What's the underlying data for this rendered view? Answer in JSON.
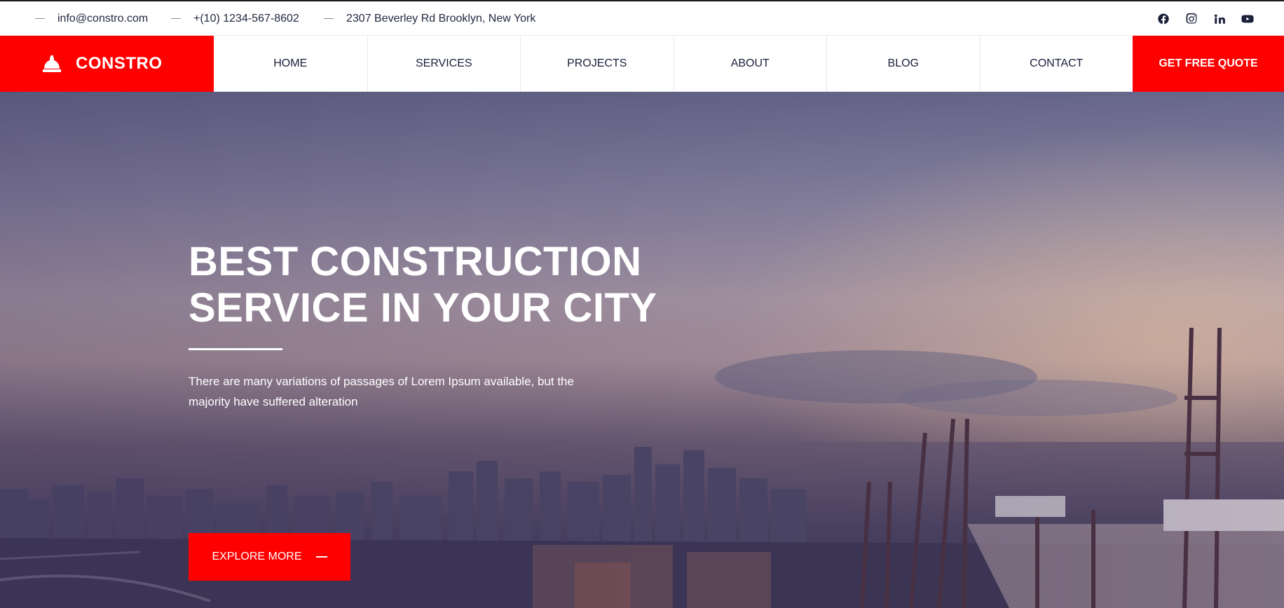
{
  "topbar": {
    "email": "info@constro.com",
    "phone": "+(10) 1234-567-8602",
    "address": "2307 Beverley Rd Brooklyn, New York",
    "socials": [
      "facebook-icon",
      "instagram-icon",
      "linkedin-icon",
      "youtube-icon"
    ]
  },
  "brand": {
    "name": "CONSTRO",
    "icon": "helmet-icon",
    "color": "#ff0000"
  },
  "nav": {
    "items": [
      {
        "label": "HOME"
      },
      {
        "label": "SERVICES"
      },
      {
        "label": "PROJECTS"
      },
      {
        "label": "ABOUT"
      },
      {
        "label": "BLOG"
      },
      {
        "label": "CONTACT"
      }
    ],
    "cta_label": "GET FREE QUOTE"
  },
  "hero": {
    "title_line1": "BEST CONSTRUCTION",
    "title_line2": "SERVICE IN YOUR CITY",
    "text": "There are many variations of passages of Lorem Ipsum available, but the majority have suffered alteration",
    "button_label": "EXPLORE MORE"
  }
}
